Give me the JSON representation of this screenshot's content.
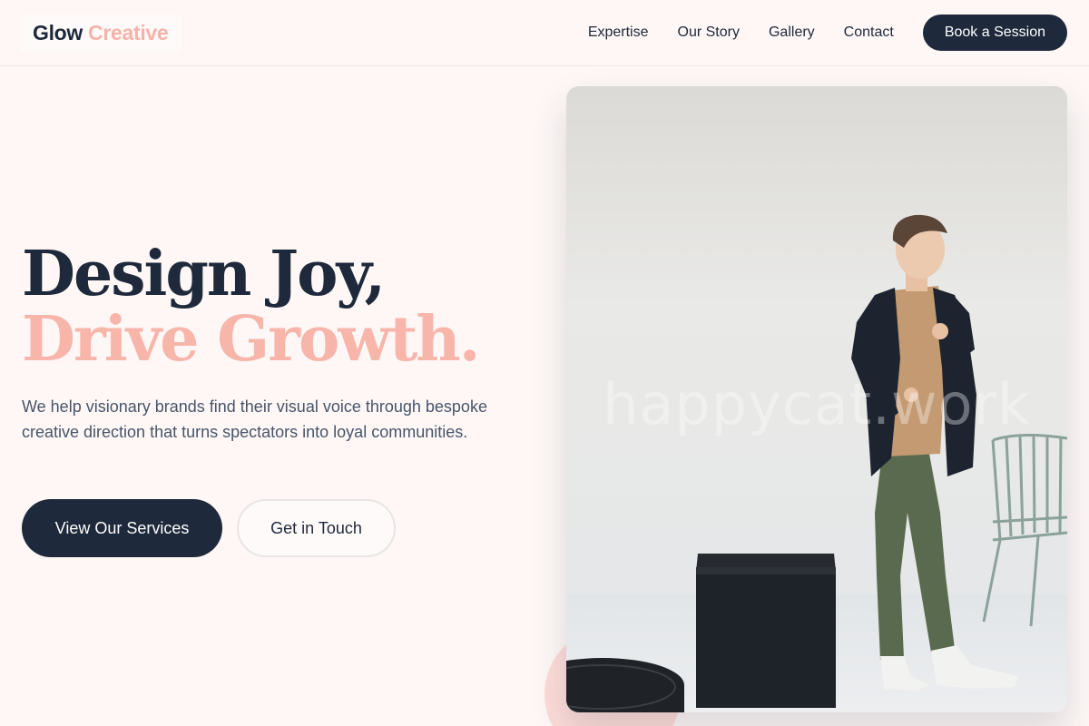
{
  "header": {
    "brand_main": "Glow",
    "brand_accent": "Creative",
    "nav": [
      "Expertise",
      "Our Story",
      "Gallery",
      "Contact"
    ],
    "cta": "Book a Session"
  },
  "hero": {
    "title_line1": "Design Joy,",
    "title_line2": "Drive Growth.",
    "description": "We help visionary brands find their visual voice through bespoke creative direction that turns spectators into loyal communities.",
    "primary_button": "View Our Services",
    "secondary_button": "Get in Touch"
  },
  "image": {
    "watermark": "happycat.work"
  },
  "colors": {
    "navy": "#1e293b",
    "accent": "#f6b3a9",
    "background": "#fef7f6"
  }
}
